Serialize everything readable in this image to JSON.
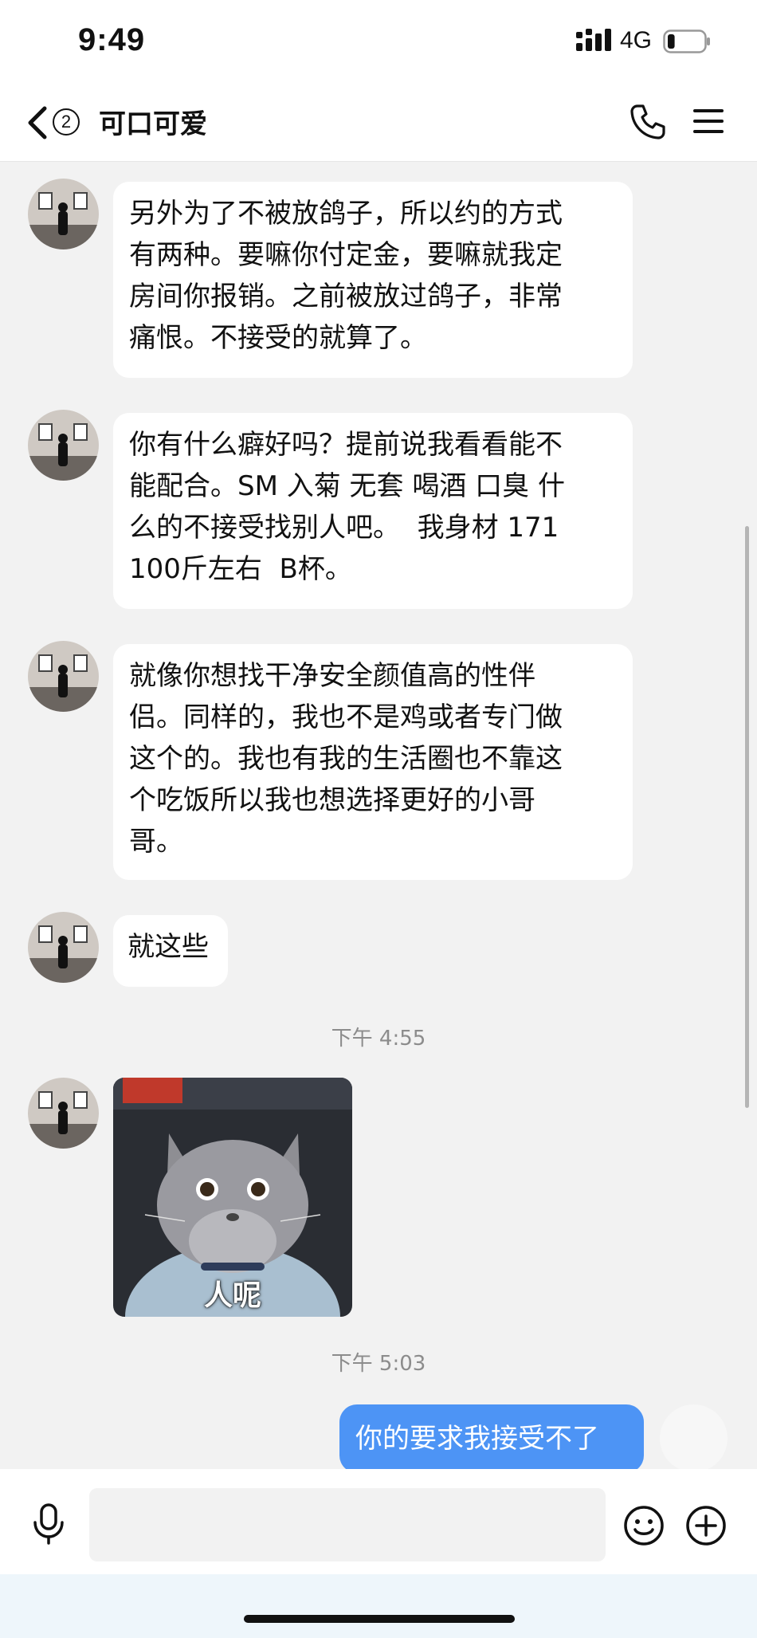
{
  "status_bar": {
    "time": "9:49",
    "network": "4G",
    "battery_level": 0.2
  },
  "header": {
    "back_icon": "chevron-left-icon",
    "unread_count": "2",
    "title": "可口可爱",
    "call_icon": "phone-icon",
    "menu_icon": "hamburger-menu-icon"
  },
  "messages": [
    {
      "side": "incoming",
      "type": "text",
      "text": "另外为了不被放鸽子，所以约的方式\n有两种。要嘛你付定金，要嘛就我定\n房间你报销。之前被放过鸽子，非常\n痛恨。不接受的就算了。"
    },
    {
      "side": "incoming",
      "type": "text",
      "text": "你有什么癖好吗？提前说我看看能不\n能配合。SM 入菊 无套 喝酒 口臭 什\n么的不接受找别人吧。  我身材 171\n100斤左右  B杯。"
    },
    {
      "side": "incoming",
      "type": "text",
      "text": "就像你想找干净安全颜值高的性伴\n侣。同样的，我也不是鸡或者专门做\n这个的。我也有我的生活圈也不靠这\n个吃饭所以我也想选择更好的小哥\n哥。"
    },
    {
      "side": "incoming",
      "type": "text",
      "text": "就这些"
    },
    {
      "type": "timestamp",
      "text": "下午 4:55"
    },
    {
      "side": "incoming",
      "type": "sticker",
      "caption": "人呢"
    },
    {
      "type": "timestamp",
      "text": "下午 5:03"
    },
    {
      "side": "outgoing",
      "type": "text",
      "text": "你的要求我接受不了"
    }
  ],
  "input_bar": {
    "voice_icon": "microphone-icon",
    "placeholder": "",
    "emoji_icon": "smiley-icon",
    "more_icon": "plus-circle-icon"
  },
  "colors": {
    "outgoing_bubble": "#4d94f5",
    "incoming_bubble": "#ffffff",
    "chat_background": "#f2f2f2"
  }
}
